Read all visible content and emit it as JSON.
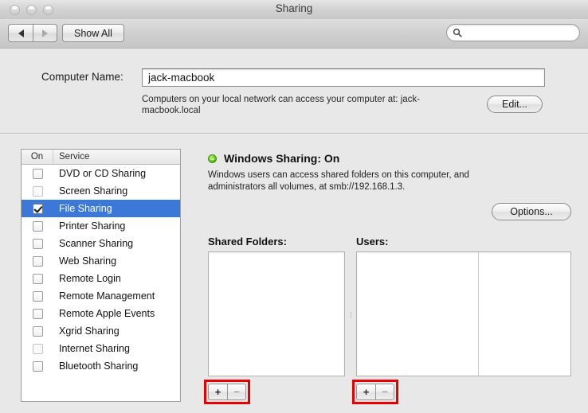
{
  "window": {
    "title": "Sharing",
    "traffic_lights": [
      "close",
      "minimize",
      "maximize"
    ]
  },
  "toolbar": {
    "back_label": "◀",
    "forward_label": "▶",
    "show_all_label": "Show All",
    "search_value": "",
    "search_placeholder": ""
  },
  "computer_name": {
    "label": "Computer Name:",
    "value": "jack-macbook",
    "placeholder": "",
    "note": "Computers on your local network can access your computer at: jack-macbook.local",
    "edit_label": "Edit..."
  },
  "services": {
    "header": {
      "on": "On",
      "service": "Service"
    },
    "items": [
      {
        "label": "DVD or CD Sharing",
        "checked": false,
        "selected": false,
        "dim": false
      },
      {
        "label": "Screen Sharing",
        "checked": false,
        "selected": false,
        "dim": true
      },
      {
        "label": "File Sharing",
        "checked": true,
        "selected": true,
        "dim": false
      },
      {
        "label": "Printer Sharing",
        "checked": false,
        "selected": false,
        "dim": false
      },
      {
        "label": "Scanner Sharing",
        "checked": false,
        "selected": false,
        "dim": false
      },
      {
        "label": "Web Sharing",
        "checked": false,
        "selected": false,
        "dim": false
      },
      {
        "label": "Remote Login",
        "checked": false,
        "selected": false,
        "dim": false
      },
      {
        "label": "Remote Management",
        "checked": false,
        "selected": false,
        "dim": false
      },
      {
        "label": "Remote Apple Events",
        "checked": false,
        "selected": false,
        "dim": false
      },
      {
        "label": "Xgrid Sharing",
        "checked": false,
        "selected": false,
        "dim": false
      },
      {
        "label": "Internet Sharing",
        "checked": false,
        "selected": false,
        "dim": true
      },
      {
        "label": "Bluetooth Sharing",
        "checked": false,
        "selected": false,
        "dim": false
      }
    ]
  },
  "detail": {
    "status_title": "Windows Sharing: On",
    "status_color": "#5cbf15",
    "description": "Windows users can access shared folders on this computer, and administrators all volumes, at smb://192.168.1.3.",
    "options_label": "Options...",
    "shared_folders_label": "Shared Folders:",
    "users_label": "Users:",
    "shared_folders_items": [],
    "users_items": [],
    "add_label": "+",
    "remove_label": "−"
  },
  "annotations": {
    "highlight_color": "#e60000",
    "boxes": [
      "shared-folders-add-remove",
      "users-add-remove"
    ]
  }
}
